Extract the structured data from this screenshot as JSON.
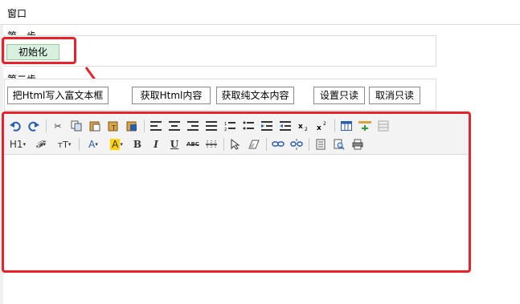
{
  "window": {
    "title": "窗口"
  },
  "step1": {
    "label": "第一步",
    "init_button": "初始化"
  },
  "step2": {
    "label": "第二步",
    "buttons": [
      "把Html写入富文本框",
      "获取Html内容",
      "获取纯文本内容",
      "设置只读",
      "取消只读"
    ]
  },
  "toolbar": {
    "row1": [
      "undo-icon",
      "redo-icon",
      "|",
      "cut-icon",
      "copy-icon",
      "paste-icon",
      "paste-text-icon",
      "paste-word-icon",
      "|",
      "align-left-icon",
      "align-center-icon",
      "align-right-icon",
      "align-justify-icon",
      "ordered-list-icon",
      "unordered-list-icon",
      "indent-icon",
      "outdent-icon",
      "subscript-icon",
      "superscript-icon",
      "|",
      "table-icon",
      "insert-row-icon",
      "delete-table-icon"
    ],
    "row2_labels": {
      "heading": "H1",
      "font": "𝓕",
      "size": "тT",
      "font_color": "A",
      "bg_color": "A",
      "bold": "B",
      "italic": "I",
      "underline": "U",
      "strike": "ABC"
    },
    "row2": [
      "heading-dropdown",
      "font-family-dropdown",
      "font-size-dropdown",
      "|",
      "font-color-dropdown",
      "background-color-dropdown",
      "bold-icon",
      "italic-icon",
      "underline-icon",
      "strikethrough-icon",
      "horizontal-rule-icon",
      "|",
      "select-icon",
      "eraser-icon",
      "|",
      "link-icon",
      "unlink-icon",
      "|",
      "source-icon",
      "preview-icon",
      "print-icon"
    ]
  },
  "colors": {
    "highlight": "#e8222a",
    "init_button_bg": "#d8f0dd",
    "toolbar_bg": "#f3f3f3"
  }
}
